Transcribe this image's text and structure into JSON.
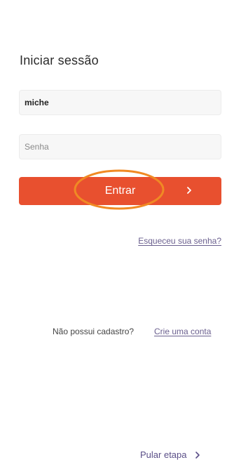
{
  "login": {
    "title": "Iniciar sessão",
    "username": {
      "value": "miche"
    },
    "password": {
      "placeholder": "Senha"
    },
    "submit_label": "Entrar"
  },
  "links": {
    "forgot_password": "Esqueceu sua senha?",
    "no_account_text": "Não possui cadastro?",
    "create_account": "Crie uma conta",
    "skip": "Pular etapa"
  },
  "colors": {
    "primary_button": "#e8502f",
    "highlight_ring": "#f08a24",
    "link": "#6a5f8e"
  },
  "icons": {
    "submit_chevron": "chevron-right-icon",
    "skip_chevron": "chevron-right-icon"
  }
}
